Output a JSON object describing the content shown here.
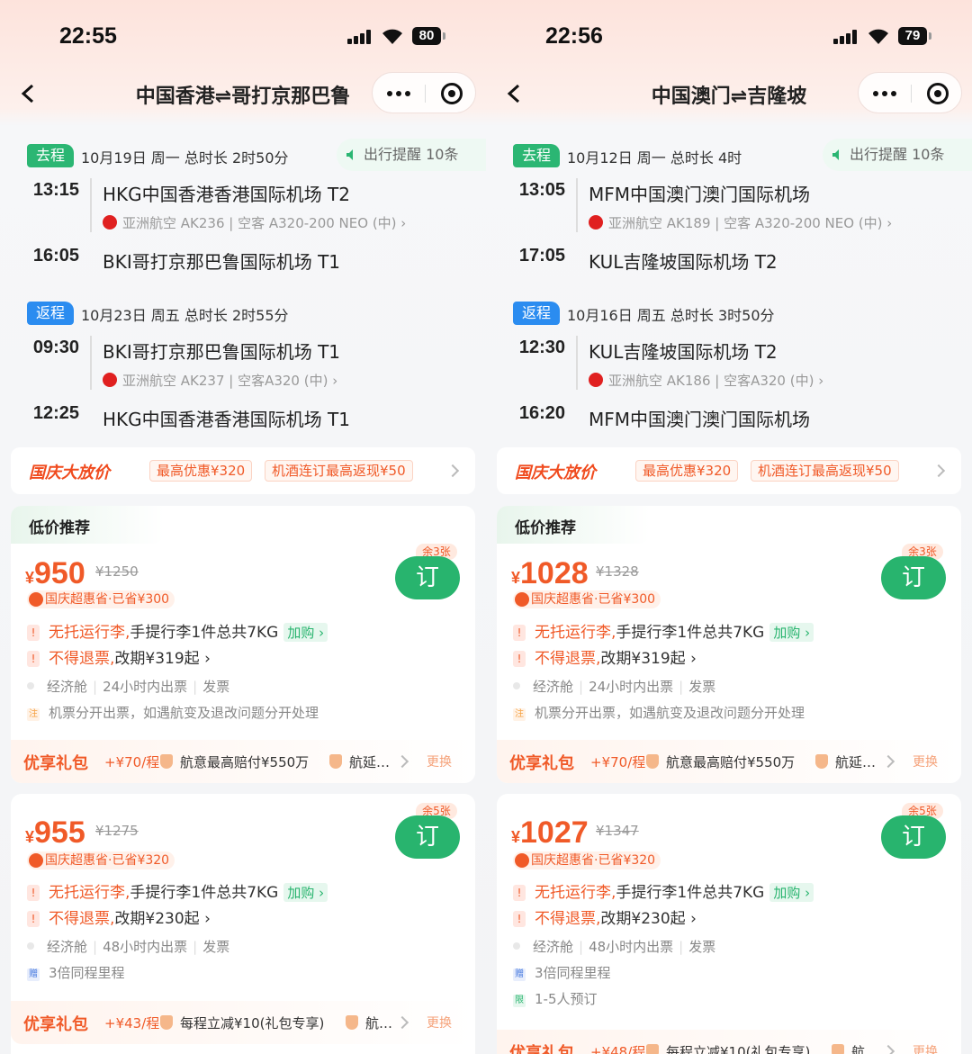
{
  "left": {
    "status": {
      "time": "22:55",
      "battery": "80"
    },
    "nav": {
      "title": "中国香港⇌哥打京那巴鲁"
    },
    "outbound": {
      "tag": "去程",
      "info": "10月19日 周一  总时长 2时50分",
      "reminder": "出行提醒 10条",
      "dep_time": "13:15",
      "dep_airport": "HKG中国香港香港国际机场 T2",
      "flight": "亚洲航空 AK236 | 空客 A320-200 NEO (中) ›",
      "arr_time": "16:05",
      "arr_airport": "BKI哥打京那巴鲁国际机场 T1"
    },
    "return": {
      "tag": "返程",
      "info": "10月23日 周五  总时长 2时55分",
      "dep_time": "09:30",
      "dep_airport": "BKI哥打京那巴鲁国际机场 T1",
      "flight": "亚洲航空 AK237 | 空客A320 (中) ›",
      "arr_time": "12:25",
      "arr_airport": "HKG中国香港香港国际机场 T1"
    },
    "promo": {
      "title": "国庆大放价",
      "chip1": "最高优惠¥320",
      "chip2": "机酒连订最高返现¥50"
    },
    "card1": {
      "label": "低价推荐",
      "price": "950",
      "old_price": "¥1250",
      "saving": "国庆超惠省·已省¥300",
      "remaining": "余3张",
      "book": "订",
      "rule1_warn": "无托运行李,",
      "rule1_text": "手提行李1件总共7KG",
      "addbuy": "加购 ›",
      "rule2_warn": "不得退票,",
      "rule2_text": "改期¥319起 ›",
      "meta": [
        "经济舱",
        "24小时内出票",
        "发票"
      ],
      "note": "机票分开出票，如遇航变及退改问题分开处理",
      "gift_title": "优享礼包",
      "gift_price": "+¥70/程",
      "gift_item1": "航意最高赔付¥550万",
      "gift_item2": "航延…",
      "swap": "更换"
    },
    "card2": {
      "price": "955",
      "old_price": "¥1275",
      "saving": "国庆超惠省·已省¥320",
      "remaining": "余5张",
      "book": "订",
      "rule1_warn": "无托运行李,",
      "rule1_text": "手提行李1件总共7KG",
      "addbuy": "加购 ›",
      "rule2_warn": "不得退票,",
      "rule2_text": "改期¥230起 ›",
      "meta": [
        "经济舱",
        "48小时内出票",
        "发票"
      ],
      "extra1": "3倍同程里程",
      "gift_title": "优享礼包",
      "gift_price": "+¥43/程",
      "gift_item1": "每程立减¥10(礼包专享)",
      "gift_item2": "航…",
      "swap": "更换"
    }
  },
  "right": {
    "status": {
      "time": "22:56",
      "battery": "79"
    },
    "nav": {
      "title": "中国澳门⇌吉隆坡"
    },
    "outbound": {
      "tag": "去程",
      "info": "10月12日 周一  总时长 4时",
      "reminder": "出行提醒 10条",
      "dep_time": "13:05",
      "dep_airport": "MFM中国澳门澳门国际机场",
      "flight": "亚洲航空 AK189 | 空客 A320-200 NEO (中) ›",
      "arr_time": "17:05",
      "arr_airport": "KUL吉隆坡国际机场 T2"
    },
    "return": {
      "tag": "返程",
      "info": "10月16日 周五  总时长 3时50分",
      "dep_time": "12:30",
      "dep_airport": "KUL吉隆坡国际机场 T2",
      "flight": "亚洲航空 AK186 | 空客A320 (中) ›",
      "arr_time": "16:20",
      "arr_airport": "MFM中国澳门澳门国际机场"
    },
    "promo": {
      "title": "国庆大放价",
      "chip1": "最高优惠¥320",
      "chip2": "机酒连订最高返现¥50"
    },
    "card1": {
      "label": "低价推荐",
      "price": "1028",
      "old_price": "¥1328",
      "saving": "国庆超惠省·已省¥300",
      "remaining": "余3张",
      "book": "订",
      "rule1_warn": "无托运行李,",
      "rule1_text": "手提行李1件总共7KG",
      "addbuy": "加购 ›",
      "rule2_warn": "不得退票,",
      "rule2_text": "改期¥319起 ›",
      "meta": [
        "经济舱",
        "24小时内出票",
        "发票"
      ],
      "note": "机票分开出票，如遇航变及退改问题分开处理",
      "gift_title": "优享礼包",
      "gift_price": "+¥70/程",
      "gift_item1": "航意最高赔付¥550万",
      "gift_item2": "航延…",
      "swap": "更换"
    },
    "card2": {
      "price": "1027",
      "old_price": "¥1347",
      "saving": "国庆超惠省·已省¥320",
      "remaining": "余5张",
      "book": "订",
      "rule1_warn": "无托运行李,",
      "rule1_text": "手提行李1件总共7KG",
      "addbuy": "加购 ›",
      "rule2_warn": "不得退票,",
      "rule2_text": "改期¥230起 ›",
      "meta": [
        "经济舱",
        "48小时内出票",
        "发票"
      ],
      "extra1": "3倍同程里程",
      "extra2": "1-5人预订",
      "gift_title": "优享礼包",
      "gift_price": "+¥48/程",
      "gift_item1": "每程立减¥10(礼包专享)",
      "gift_item2": "航…",
      "swap": "更换"
    }
  },
  "icons": {
    "currency": "¥",
    "note": "注",
    "gift": "赠",
    "limit": "限",
    "warn": "!"
  },
  "colors": {
    "accent": "#f05a28",
    "book_green": "#28b46e",
    "outbound_tag": "#2bb673",
    "return_tag": "#2b8cf0"
  }
}
